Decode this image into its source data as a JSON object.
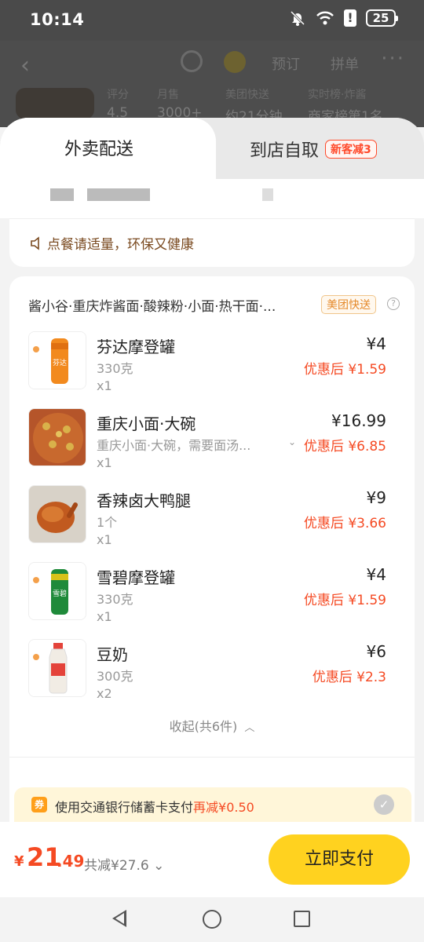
{
  "status": {
    "time": "10:14",
    "battery": "25"
  },
  "background_page": {
    "nav": [
      "预订",
      "拼单"
    ],
    "meta": [
      {
        "label": "评分",
        "value": "4.5"
      },
      {
        "label": "月售",
        "value": "3000+"
      },
      {
        "label": "美团快送",
        "value": "约21分钟"
      },
      {
        "label": "实时榜·炸酱",
        "value": "商家榜第1名"
      }
    ]
  },
  "tabs": {
    "delivery": "外卖配送",
    "pickup": "到店自取",
    "pickup_tag": "新客减3"
  },
  "notice": "点餐请适量，环保又健康",
  "order": {
    "store_name": "酱小谷·重庆炸酱面·酸辣粉·小面·热干面·...",
    "delivery_tag": "美团快送",
    "items": [
      {
        "name": "芬达摩登罐",
        "spec": "330克",
        "qty": "x1",
        "price": "¥4",
        "discount": "优惠后 ¥1.59"
      },
      {
        "name": "重庆小面·大碗",
        "spec": "重庆小面·大碗，需要面汤...",
        "qty": "x1",
        "price": "¥16.99",
        "discount": "优惠后 ¥6.85"
      },
      {
        "name": "香辣卤大鸭腿",
        "spec": "1个",
        "qty": "x1",
        "price": "¥9",
        "discount": "优惠后 ¥3.66"
      },
      {
        "name": "雪碧摩登罐",
        "spec": "330克",
        "qty": "x1",
        "price": "¥4",
        "discount": "优惠后 ¥1.59"
      },
      {
        "name": "豆奶",
        "spec": "300克",
        "qty": "x2",
        "price": "¥6",
        "discount": "优惠后 ¥2.3"
      }
    ],
    "collapse_label": "收起(共6件)"
  },
  "promo": {
    "text": "使用交通银行储蓄卡支付",
    "highlight": "再减¥0.50"
  },
  "pay": {
    "currency": "¥",
    "amount_int": "21",
    "amount_dec": ".49",
    "saved": "共减¥27.6",
    "button": "立即支付"
  },
  "colors": {
    "accent_red": "#f54a23",
    "pay_yellow": "#ffd21f"
  }
}
